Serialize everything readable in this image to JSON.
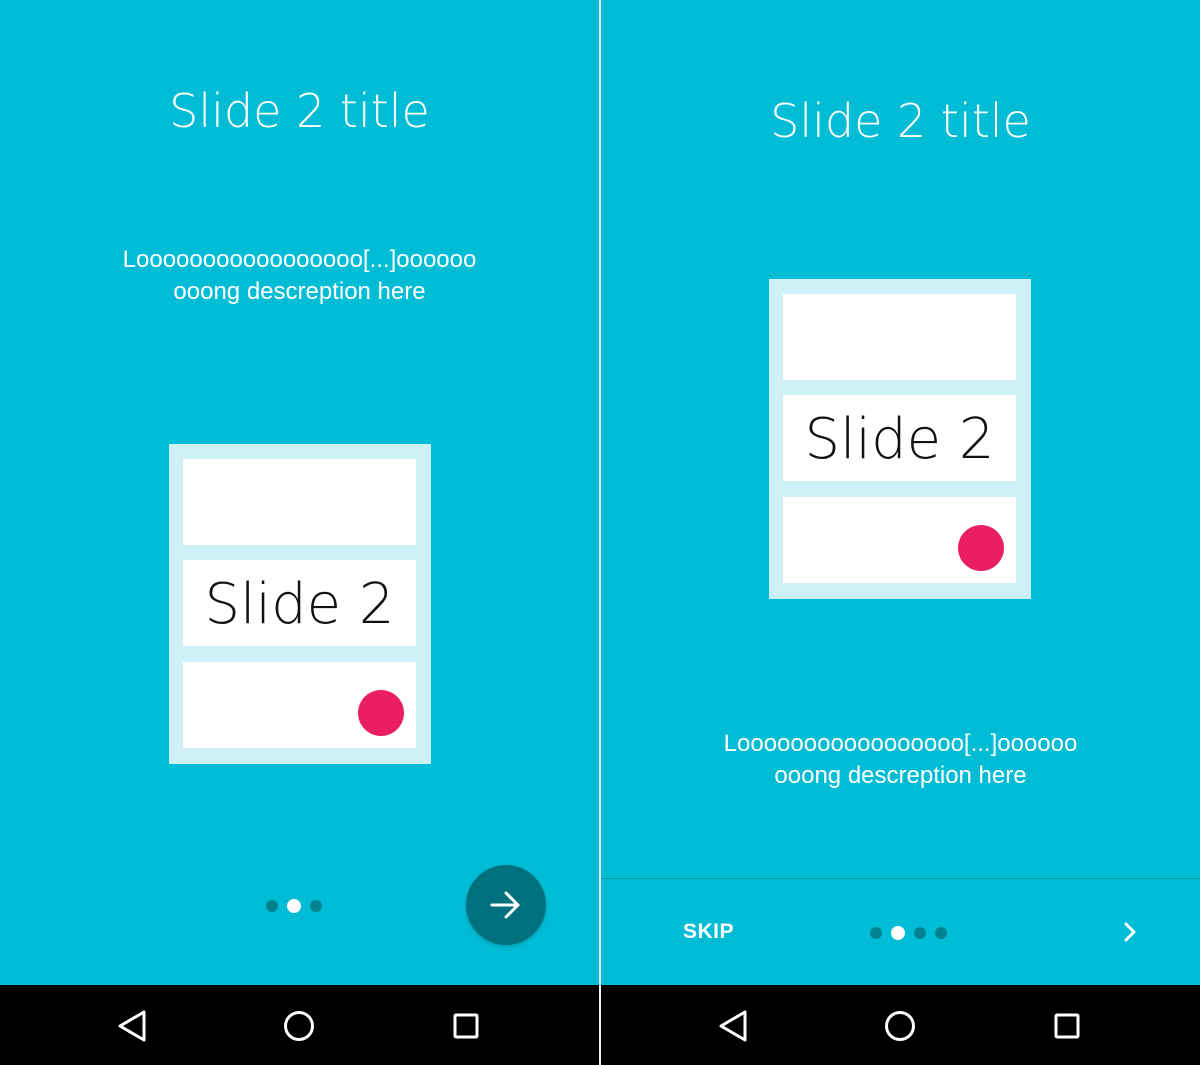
{
  "left_screen": {
    "title": "Slide 2 title",
    "description_line1": "Looooooooooooooooo[...]oooooo",
    "description_line2": "ooong descreption here",
    "card_label": "Slide 2",
    "page_indicator": {
      "count": 3,
      "active_index": 1
    },
    "next_button_icon": "arrow-right-icon"
  },
  "right_screen": {
    "title": "Slide 2 title",
    "description_line1": "Looooooooooooooooo[...]oooooo",
    "description_line2": "ooong descreption here",
    "card_label": "Slide 2",
    "skip_label": "SKIP",
    "page_indicator": {
      "count": 4,
      "active_index": 1
    },
    "next_icon": "chevron-right-icon"
  },
  "nav_bar": {
    "back_icon": "back-triangle-icon",
    "home_icon": "home-circle-icon",
    "recents_icon": "recents-square-icon"
  },
  "colors": {
    "background": "#00BCD4",
    "card_frame": "#CDF1F6",
    "accent_dot": "#E91E63",
    "fab": "#00707E",
    "inactive_indicator": "#00838F",
    "nav_bar": "#000000"
  }
}
